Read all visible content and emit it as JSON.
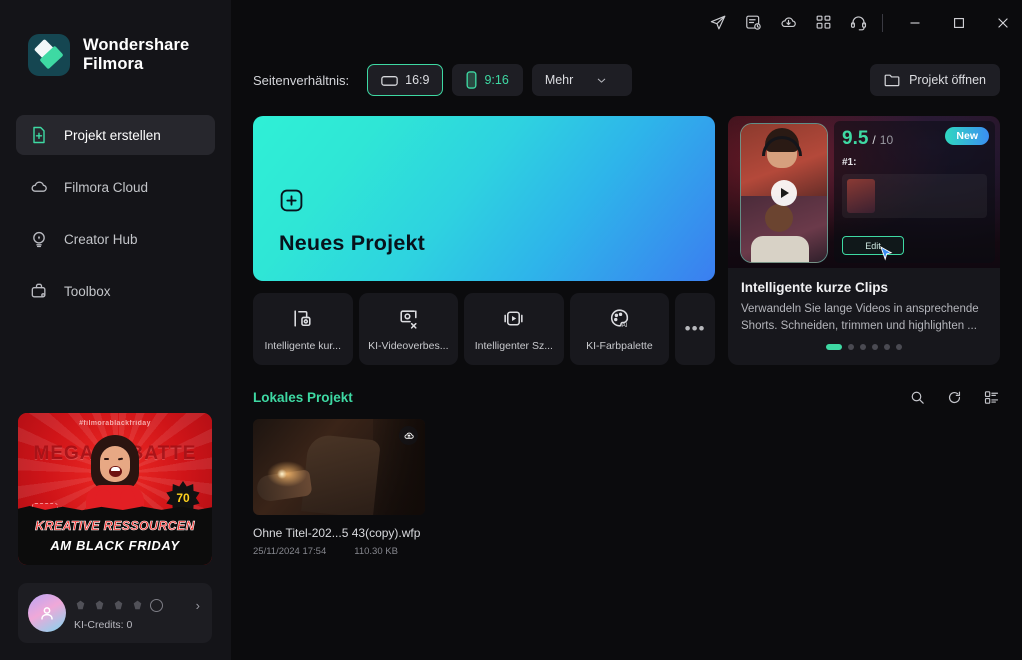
{
  "brand": {
    "line1": "Wondershare",
    "line2": "Filmora",
    "logo_bg": "#154651",
    "logo_accent": "#3ed9a3"
  },
  "sidebar": {
    "items": [
      {
        "label": "Projekt erstellen",
        "icon": "file-plus-icon",
        "active": true
      },
      {
        "label": "Filmora Cloud",
        "icon": "cloud-icon",
        "active": false
      },
      {
        "label": "Creator Hub",
        "icon": "lightbulb-icon",
        "active": false
      },
      {
        "label": "Toolbox",
        "icon": "toolbox-icon",
        "active": false
      }
    ],
    "promo_banner": {
      "hashtag": "#filmorablackfriday",
      "wordmark": "MEGA RABATTE",
      "burst": "70",
      "line1": "KREATIVE RESSOURCEN",
      "line2": "AM BLACK FRIDAY"
    },
    "user": {
      "credits_label": "KI-Credits: 0",
      "chevron": "›"
    }
  },
  "titlebar": {
    "icons": [
      {
        "name": "send-icon"
      },
      {
        "name": "task-list-icon"
      },
      {
        "name": "cloud-download-icon"
      },
      {
        "name": "apps-grid-icon"
      },
      {
        "name": "headset-support-icon"
      }
    ],
    "minimize": "–",
    "maximize": "□",
    "close": "✕"
  },
  "toolbar": {
    "aspect_label": "Seitenverhältnis:",
    "ratios": [
      {
        "value": "16:9",
        "icon": "landscape-icon",
        "selected": true
      },
      {
        "value": "9:16",
        "icon": "portrait-icon",
        "selected": false
      }
    ],
    "more_label": "Mehr",
    "open_project_label": "Projekt öffnen"
  },
  "main": {
    "new_project": {
      "title": "Neues Projekt",
      "icon": "plus-square-icon"
    },
    "tiles": [
      {
        "label": "Intelligente kur...",
        "icon": "smart-shorts-icon"
      },
      {
        "label": "KI-Videoverbes...",
        "icon": "ai-video-enhance-icon"
      },
      {
        "label": "Intelligenter Sz...",
        "icon": "smart-scene-icon"
      },
      {
        "label": "KI-Farbpalette",
        "icon": "ai-color-palette-icon"
      }
    ],
    "tiles_more": "•••",
    "promo": {
      "score": "9.5",
      "score_sep": "/",
      "score_max": "10",
      "badge": "New",
      "rank": "#1:",
      "edit_button": "Edit",
      "title": "Intelligente kurze Clips",
      "description": "Verwandeln Sie lange Videos in ansprechende Shorts. Schneiden, trimmen und highlighten ...",
      "dots_count": 6,
      "active_dot": 0
    },
    "local": {
      "title": "Lokales Projekt",
      "icons": [
        {
          "name": "search-icon"
        },
        {
          "name": "refresh-icon"
        },
        {
          "name": "list-view-icon"
        }
      ],
      "project": {
        "name": "Ohne Titel-202...5 43(copy).wfp",
        "date": "25/11/2024 17:54",
        "size": "110.30 KB",
        "badge_icon": "cloud-upload-icon"
      }
    }
  },
  "colors": {
    "accent": "#3ed9a3",
    "bg": "#0b0b0d",
    "sidebar_bg": "#141418",
    "card_bg": "#18181d"
  }
}
